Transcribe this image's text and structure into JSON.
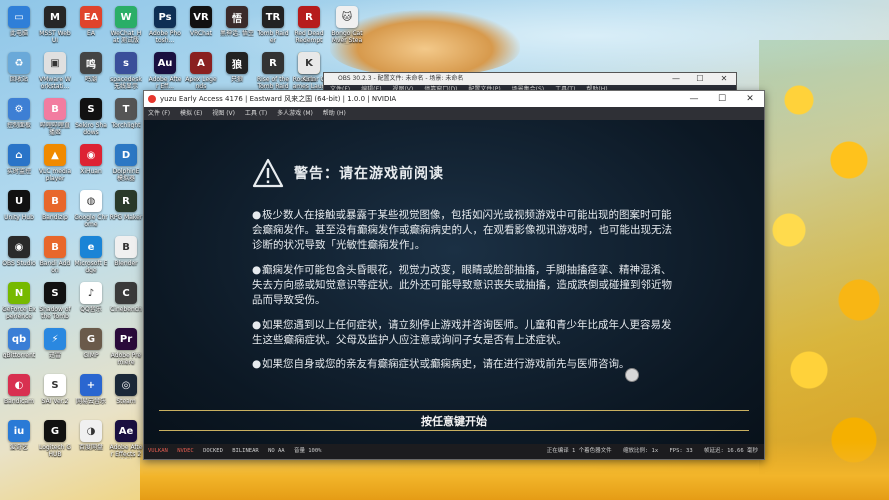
{
  "desktop_icons": [
    {
      "label": "此电脑",
      "color": "#2f7fd8",
      "glyph": "▭"
    },
    {
      "label": "MSST WebUI",
      "color": "#262626",
      "glyph": "M"
    },
    {
      "label": "EA",
      "color": "#e0432c",
      "glyph": "EA"
    },
    {
      "label": "WeChat_Hat 测试版",
      "color": "#2aae67",
      "glyph": "W"
    },
    {
      "label": "Adobe Photosh...",
      "color": "#0f2f54",
      "glyph": "Ps"
    },
    {
      "label": "VRChat",
      "color": "#111",
      "glyph": "VR"
    },
    {
      "label": "黑神话: 悟空",
      "color": "#3a2a2a",
      "glyph": "悟"
    },
    {
      "label": "Tomb Raider",
      "color": "#222",
      "glyph": "TR"
    },
    {
      "label": "Red Dead Redempti...",
      "color": "#b61c1c",
      "glyph": "R"
    },
    {
      "label": "Bongo Cat Mver Steam",
      "color": "#f0f0f0",
      "glyph": "🐱"
    },
    {
      "label": "回收站",
      "color": "#6aa9d9",
      "glyph": "♻"
    },
    {
      "label": "VMware Workstati...",
      "color": "#e0e0e0",
      "glyph": "▣"
    },
    {
      "label": "鸣潮",
      "color": "#444",
      "glyph": "鸣"
    },
    {
      "label": "spacedesk 无线显示",
      "color": "#3a4f9a",
      "glyph": "s"
    },
    {
      "label": "Adobe After Eff...",
      "color": "#1a1040",
      "glyph": "Au"
    },
    {
      "label": "Apex Legends",
      "color": "#8a2020",
      "glyph": "A"
    },
    {
      "label": "只狼",
      "color": "#222",
      "glyph": "狼"
    },
    {
      "label": "Rise of the Tomb Raider",
      "color": "#333",
      "glyph": "R"
    },
    {
      "label": "Rockstar Games Launcher",
      "color": "#f4b400",
      "glyph": "R"
    },
    {
      "label": "Kirin",
      "color": "#e8e8e8",
      "glyph": "K"
    },
    {
      "label": "控制面板",
      "color": "#3d7fd4",
      "glyph": "⚙"
    },
    {
      "label": "哔哩哔哩直播姬",
      "color": "#f27ca0",
      "glyph": "B"
    },
    {
      "label": "Sekiro Shadows",
      "color": "#111",
      "glyph": "S"
    },
    {
      "label": "Torchlight",
      "color": "#555",
      "glyph": "T"
    },
    {
      "label": "实时监控",
      "color": "#2a74c8",
      "glyph": "⌂"
    },
    {
      "label": "VLC media player",
      "color": "#f08a00",
      "glyph": "▲"
    },
    {
      "label": "XiHuan",
      "color": "#d23",
      "glyph": "◉"
    },
    {
      "label": "DolphinE 模拟器",
      "color": "#2c78c4",
      "glyph": "D"
    },
    {
      "label": "Unity Hub",
      "color": "#111",
      "glyph": "U"
    },
    {
      "label": "Bandizip",
      "color": "#e8672b",
      "glyph": "B"
    },
    {
      "label": "Google Chrome",
      "color": "#fff",
      "glyph": "◍"
    },
    {
      "label": "RPG Maker",
      "color": "#2a3a2a",
      "glyph": "R"
    },
    {
      "label": "OBS Studio",
      "color": "#2a2a2a",
      "glyph": "◉"
    },
    {
      "label": "Bandi Addon",
      "color": "#e8672b",
      "glyph": "B"
    },
    {
      "label": "Microsoft Edge",
      "color": "#1a84d6",
      "glyph": "e"
    },
    {
      "label": "Blender",
      "color": "#f0f0f0",
      "glyph": "B"
    },
    {
      "label": "GeForce Experience",
      "color": "#76b900",
      "glyph": "N"
    },
    {
      "label": "Shadow of the Tomb",
      "color": "#111",
      "glyph": "S"
    },
    {
      "label": "QQ音乐",
      "color": "#fff",
      "glyph": "♪"
    },
    {
      "label": "Cinebench",
      "color": "#3a3a3a",
      "glyph": "C"
    },
    {
      "label": "qBittorrent",
      "color": "#3a7ed6",
      "glyph": "qb"
    },
    {
      "label": "迅雷",
      "color": "#2a88e0",
      "glyph": "⚡"
    },
    {
      "label": "GIMP",
      "color": "#6a5a4a",
      "glyph": "G"
    },
    {
      "label": "Adobe Premiere",
      "color": "#2a0a3a",
      "glyph": "Pr"
    },
    {
      "label": "Bandicam",
      "color": "#d83050",
      "glyph": "◐"
    },
    {
      "label": "SAI Ver.2",
      "color": "#fff",
      "glyph": "S"
    },
    {
      "label": "网易云音乐",
      "color": "#2a66d0",
      "glyph": "+"
    },
    {
      "label": "Steam",
      "color": "#1b2838",
      "glyph": "◎"
    },
    {
      "label": "爱奇艺",
      "color": "#2a7ad6",
      "glyph": "iu"
    },
    {
      "label": "Logitech G HUB",
      "color": "#111",
      "glyph": "G"
    },
    {
      "label": "百度网盘",
      "color": "#f0f0f0",
      "glyph": "◑"
    },
    {
      "label": "Adobe After Effects 2024",
      "color": "#1a1040",
      "glyph": "Ae"
    }
  ],
  "obs_window": {
    "title": "OBS 30.2.3 - 配置文件: 未命名 - 场景: 未命名",
    "menu": [
      "文件(F)",
      "编辑(E)",
      "视图(V)",
      "停靠窗口(D)",
      "配置文件(P)",
      "场景集合(S)",
      "工具(T)",
      "帮助(H)"
    ]
  },
  "yuzu_window": {
    "title": "yuzu Early Access 4176 | Eastward 风来之国 (64-bit) | 1.0.0 | NVIDIA",
    "menu": [
      "文件 (F)",
      "模拟 (E)",
      "视图 (V)",
      "工具 (T)",
      "多人游戏 (M)",
      "帮助 (H)"
    ],
    "warning_title": "警告：请在游戏前阅读",
    "paragraphs": [
      "极少数人在接触或暴露于某些视觉图像，包括如闪光或视频游戏中可能出现的图案时可能会癫痫发作。甚至没有癫痫发作或癫痫病史的人，在观看影像视讯游戏时，也可能出现无法诊断的状况导致「光敏性癫痫发作」。",
      "癫痫发作可能包含头昏眼花，视觉力改变，眼睛或脸部抽搐，手脚抽搐痉挛、精神混淆、失去方向感或知觉意识等症状。此外还可能导致意识丧失或抽搐，造成跌倒或碰撞到邻近物品而导致受伤。",
      "如果您遇到以上任何症状，请立刻停止游戏并咨询医师。儿童和青少年比成年人更容易发生这些癫痫症状。父母及监护人应注意或询问子女是否有上述症状。",
      "如果您自身或您的亲友有癫痫症状或癫痫病史，请在进行游戏前先与医师咨询。"
    ],
    "bullet": "●",
    "press_key": "按任意键开始",
    "status_left": [
      "VULKAN",
      "NVDEC",
      "DOCKED",
      "BILINEAR",
      "NO AA",
      "音量 100%"
    ],
    "status_right": [
      "正在编译 1 个着色器文件",
      "缩放比例: 1x",
      "FPS: 33",
      "帧延迟: 16.66 毫秒"
    ]
  }
}
